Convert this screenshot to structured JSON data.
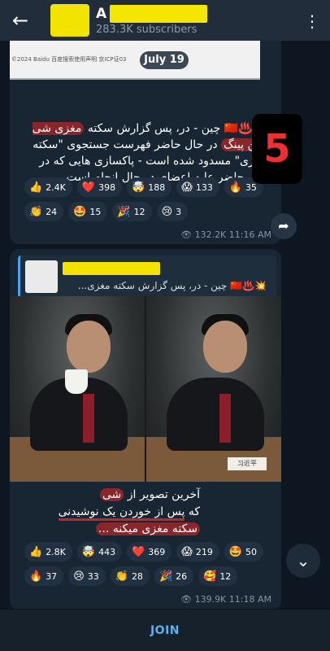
{
  "header": {
    "title_initial": "A",
    "subtitle": "283.3K subscribers"
  },
  "date_pill": "July 19",
  "message1": {
    "screenshot_strip_text": "©2024  Baidu   百度搜索使用声明   京ICP证03",
    "text_prefix": "💥♨️🇨🇳 چین - در، پس گزارش سکته",
    "text_highlight": "مغزی شی جین پینگ",
    "text_rest": "در حال حاضر فهرست جستجوی \"سکته مغزی\" مسدود شده است - پاکسازی هایی که در حال حاضر علیه اعضای در حال انجام است.",
    "badge": "5",
    "reactions": [
      {
        "emoji": "👍",
        "count": "2.4K"
      },
      {
        "emoji": "❤️",
        "count": "398"
      },
      {
        "emoji": "🤯",
        "count": "188"
      },
      {
        "emoji": "😱",
        "count": "133"
      },
      {
        "emoji": "🔥",
        "count": "35"
      },
      {
        "emoji": "👏",
        "count": "24"
      },
      {
        "emoji": "🤩",
        "count": "15"
      },
      {
        "emoji": "🎉",
        "count": "12"
      },
      {
        "emoji": "😢",
        "count": "3"
      }
    ],
    "views": "👁 132.2K",
    "time": "11:16 AM"
  },
  "message2": {
    "quote_text": "💥♨️🇨🇳 چین - در، پس گزارش سکته مغزی...",
    "nameplate": "习近平",
    "line1_a": "آخرین تصویر از",
    "line1_b": "شی",
    "line2_a": "که",
    "line2_b": "پس از خوردن یک نوشیدنی",
    "line3": "سکته مغزی میکنه ...",
    "reactions": [
      {
        "emoji": "👍",
        "count": "2.8K"
      },
      {
        "emoji": "🤯",
        "count": "443"
      },
      {
        "emoji": "❤️",
        "count": "369"
      },
      {
        "emoji": "😱",
        "count": "219"
      },
      {
        "emoji": "🤩",
        "count": "50"
      },
      {
        "emoji": "🔥",
        "count": "37"
      },
      {
        "emoji": "😢",
        "count": "33"
      },
      {
        "emoji": "👏",
        "count": "28"
      },
      {
        "emoji": "🎉",
        "count": "26"
      },
      {
        "emoji": "🥰",
        "count": "12"
      }
    ],
    "views": "👁 139.9K",
    "time": "11:18 AM"
  },
  "footer": {
    "join_label": "JOIN"
  }
}
